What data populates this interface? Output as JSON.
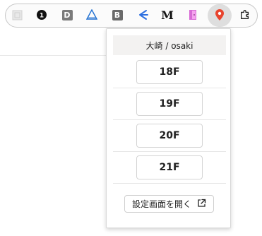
{
  "toolbar": {
    "ext_d_label": "D",
    "ext_b_label": "B",
    "ext_m_label": "M",
    "ext_1_label": "1"
  },
  "popup": {
    "title": "大崎 / osaki",
    "floors": [
      "18F",
      "19F",
      "20F",
      "21F"
    ],
    "settings_label": "設定画面を開く"
  }
}
